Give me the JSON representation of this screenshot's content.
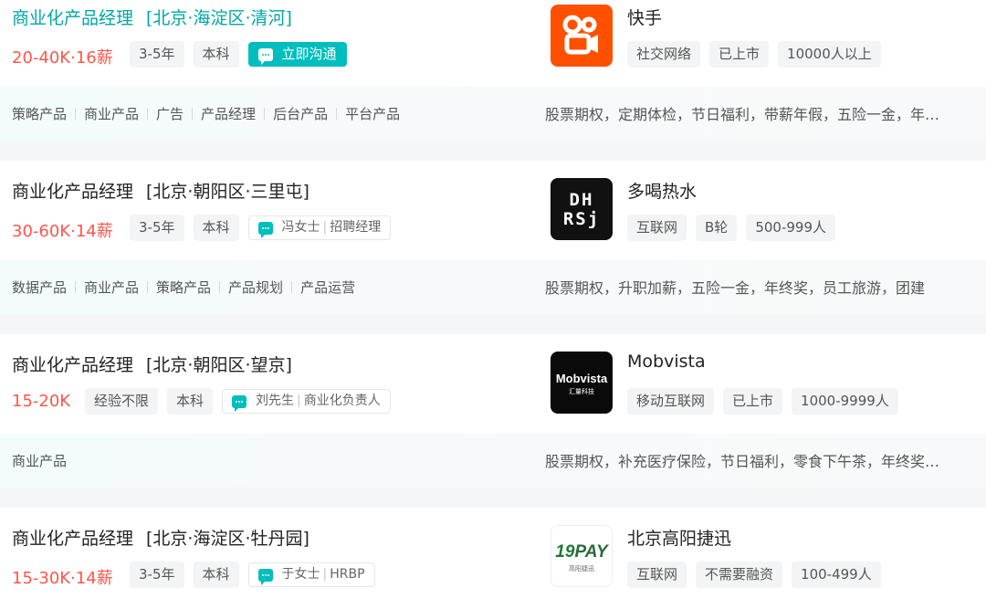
{
  "colors": {
    "salary": "#fe574a",
    "accent": "#00bebd",
    "kuaishou": "#ff5000"
  },
  "jobs": [
    {
      "title": "商业化产品经理",
      "location": "[北京·海淀区·清河]",
      "salary": "20-40K·16薪",
      "tags": [
        "3-5年",
        "本科"
      ],
      "chat": {
        "label": "立即沟通",
        "icon": "chat-bubble-icon"
      },
      "company": {
        "name": "快手",
        "logo": "kuaishou-logo",
        "tags": [
          "社交网络",
          "已上市",
          "10000人以上"
        ]
      },
      "skills": [
        "策略产品",
        "商业产品",
        "广告",
        "产品经理",
        "后台产品",
        "平台产品"
      ],
      "welfare": "股票期权，定期体检，节日福利，带薪年假，五险一金，年终奖"
    },
    {
      "title": "商业化产品经理",
      "location": "[北京·朝阳区·三里屯]",
      "salary": "30-60K·14薪",
      "tags": [
        "3-5年",
        "本科"
      ],
      "chat": {
        "name": "冯女士",
        "role": "招聘经理",
        "icon": "chat-bubble-icon"
      },
      "company": {
        "name": "多喝热水",
        "logo": "dhrs-logo",
        "logo_text": [
          "DH",
          "RSj"
        ],
        "tags": [
          "互联网",
          "B轮",
          "500-999人"
        ]
      },
      "skills": [
        "数据产品",
        "商业产品",
        "策略产品",
        "产品规划",
        "产品运营"
      ],
      "welfare": "股票期权，升职加薪，五险一金，年终奖，员工旅游，团建"
    },
    {
      "title": "商业化产品经理",
      "location": "[北京·朝阳区·望京]",
      "salary": "15-20K",
      "tags": [
        "经验不限",
        "本科"
      ],
      "chat": {
        "name": "刘先生",
        "role": "商业化负责人",
        "icon": "chat-bubble-icon"
      },
      "company": {
        "name": "Mobvista",
        "logo": "mobvista-logo",
        "logo_text": [
          "Mobvista",
          "汇量科技"
        ],
        "tags": [
          "移动互联网",
          "已上市",
          "1000-9999人"
        ]
      },
      "skills": [
        "商业产品"
      ],
      "welfare": "股票期权，补充医疗保险，节日福利，零食下午茶，年终奖，五险一金"
    },
    {
      "title": "商业化产品经理",
      "location": "[北京·海淀区·牡丹园]",
      "salary": "15-30K·14薪",
      "tags": [
        "3-5年",
        "本科"
      ],
      "chat": {
        "name": "于女士",
        "role": "HRBP",
        "icon": "chat-bubble-icon"
      },
      "company": {
        "name": "北京高阳捷迅",
        "logo": "19pay-logo",
        "logo_text": [
          "19",
          "PAY",
          "高阳捷迅"
        ],
        "tags": [
          "互联网",
          "不需要融资",
          "100-499人"
        ]
      },
      "skills": [],
      "welfare": ""
    }
  ]
}
